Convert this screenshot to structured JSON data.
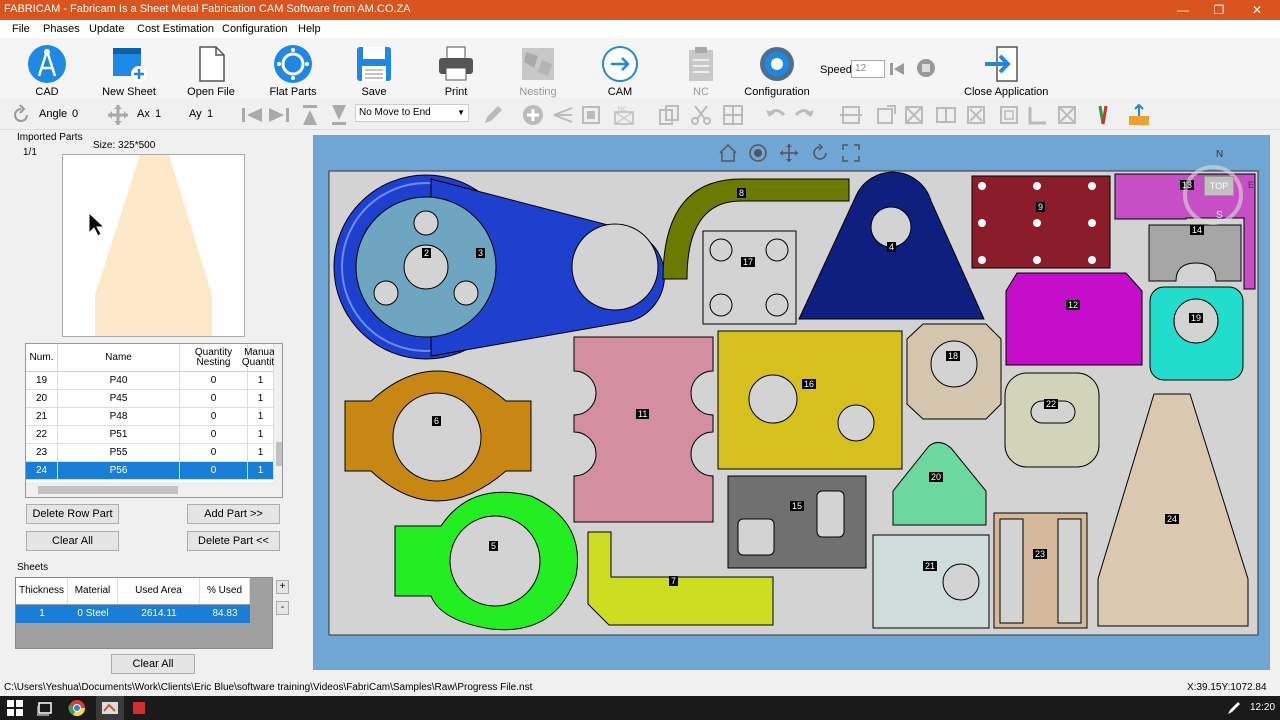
{
  "window": {
    "title": "FABRICAM - Fabricam Is a Sheet Metal Fabrication CAM Software from AM.CO.ZA",
    "minimize": "—",
    "maximize": "❐",
    "close": "✕"
  },
  "menu": [
    "File",
    "Phases",
    "Update",
    "Cost Estimation",
    "Configuration",
    "Help"
  ],
  "ribbon": {
    "cad": "CAD",
    "new_sheet": "New Sheet",
    "open_file": "Open File",
    "flat_parts": "Flat Parts",
    "save": "Save",
    "print": "Print",
    "nesting": "Nesting",
    "cam": "CAM",
    "nc": "NC",
    "configuration": "Configuration",
    "speed_label": "Speed",
    "speed_value": "12",
    "close_app": "Close Application"
  },
  "toolbar": {
    "angle_label": "Angle",
    "angle_value": "0",
    "ax_label": "Ax",
    "ax_value": "1",
    "ay_label": "Ay",
    "ay_value": "1",
    "move_select": "No Move to End"
  },
  "left": {
    "imported_label": "Imported Parts",
    "page": "1/1",
    "size": "Size: 325*500",
    "columns": [
      "Num.",
      "Name",
      "Quantity Nesting",
      "Manual Quantity"
    ],
    "rows": [
      {
        "num": "19",
        "name": "P40",
        "qn": "0",
        "mq": "1"
      },
      {
        "num": "20",
        "name": "P45",
        "qn": "0",
        "mq": "1"
      },
      {
        "num": "21",
        "name": "P48",
        "qn": "0",
        "mq": "1"
      },
      {
        "num": "22",
        "name": "P51",
        "qn": "0",
        "mq": "1"
      },
      {
        "num": "23",
        "name": "P55",
        "qn": "0",
        "mq": "1"
      },
      {
        "num": "24",
        "name": "P56",
        "qn": "0",
        "mq": "1"
      }
    ],
    "delete_row": "Delete Row Part",
    "add_part": "Add Part >>",
    "clear_all": "Clear All",
    "delete_part": "Delete Part <<",
    "sheets_label": "Sheets",
    "sheet_columns": [
      "Thickness",
      "Material",
      "Used Area",
      "% Used"
    ],
    "sheet_row": {
      "thickness": "1",
      "material": "0  Steel",
      "used_area": "2614.11",
      "used": "84.83"
    },
    "sheet_plus": "+",
    "sheet_minus": "-",
    "sheets_clear": "Clear All"
  },
  "canvas": {
    "compass_n": "N",
    "compass_top": "TOP",
    "compass_s": "S",
    "compass_e": "E",
    "part_labels": [
      "2",
      "3",
      "4",
      "5",
      "6",
      "7",
      "8",
      "9",
      "11",
      "12",
      "13",
      "14",
      "15",
      "16",
      "17",
      "18",
      "19",
      "20",
      "21",
      "22",
      "23",
      "24"
    ],
    "colors": {
      "sheet": "#d3d3d3",
      "background": "#6fa6d4"
    }
  },
  "status": {
    "path": "C:\\Users\\Yeshua\\Documents\\Work\\Clients\\Eric Blue\\software training\\Videos\\FabriCam\\Samples\\Raw\\Progress File.nst",
    "coords": "X:39.15Y:1072.84"
  },
  "taskbar": {
    "time": "12:20"
  }
}
